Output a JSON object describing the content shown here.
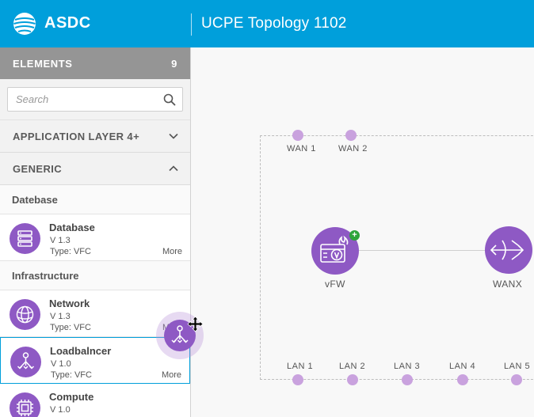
{
  "header": {
    "brand": "ASDC",
    "title": "UCPE Topology 1102"
  },
  "sidebar": {
    "elements_label": "ELEMENTS",
    "elements_count": "9",
    "search_placeholder": "Search",
    "sections": [
      {
        "label": "APPLICATION LAYER 4+",
        "expanded": false
      },
      {
        "label": "GENERIC",
        "expanded": true
      }
    ],
    "groups": [
      {
        "label": "Datebase",
        "items": [
          {
            "name": "Database",
            "version": "V 1.3",
            "type": "Type: VFC",
            "more": "More",
            "icon": "database-icon"
          }
        ]
      },
      {
        "label": "Infrastructure",
        "items": [
          {
            "name": "Network",
            "version": "V 1.3",
            "type": "Type: VFC",
            "more": "More",
            "icon": "network-globe-icon"
          },
          {
            "name": "Loadbalncer",
            "version": "V 1.0",
            "type": "Type: VFC",
            "more": "More",
            "icon": "load-balancer-icon",
            "selected": true
          },
          {
            "name": "Compute",
            "version": "V 1.0",
            "type": "",
            "more": "",
            "icon": "cpu-chip-icon"
          }
        ]
      }
    ]
  },
  "canvas": {
    "ports_top": [
      "WAN 1",
      "WAN 2"
    ],
    "ports_bottom": [
      "LAN 1",
      "LAN 2",
      "LAN 3",
      "LAN 4",
      "LAN 5"
    ],
    "nodes": [
      {
        "label": "vFW",
        "icon": "firewall-icon"
      },
      {
        "label": "WANX",
        "icon": "wan-accelerator-icon"
      }
    ]
  },
  "colors": {
    "header_bg": "#009fdb",
    "accent_purple": "#8e59c4",
    "port_purple": "#c9a2de",
    "add_badge_green": "#2ea43b"
  }
}
